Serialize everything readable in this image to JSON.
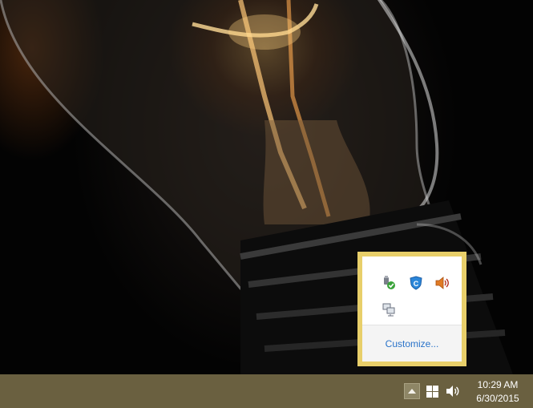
{
  "wallpaper": {
    "description_icon": "light-bulb-wallpaper"
  },
  "tray_popup": {
    "icons": [
      {
        "name": "usb-safely-remove-icon"
      },
      {
        "name": "security-shield-icon"
      },
      {
        "name": "speaker-icon"
      },
      {
        "name": "network-icon"
      }
    ],
    "customize_label": "Customize..."
  },
  "taskbar": {
    "time": "10:29 AM",
    "date": "6/30/2015"
  },
  "colors": {
    "taskbar": "#6a6040",
    "popup_border": "#e8cf6a",
    "link": "#2a73c9"
  }
}
